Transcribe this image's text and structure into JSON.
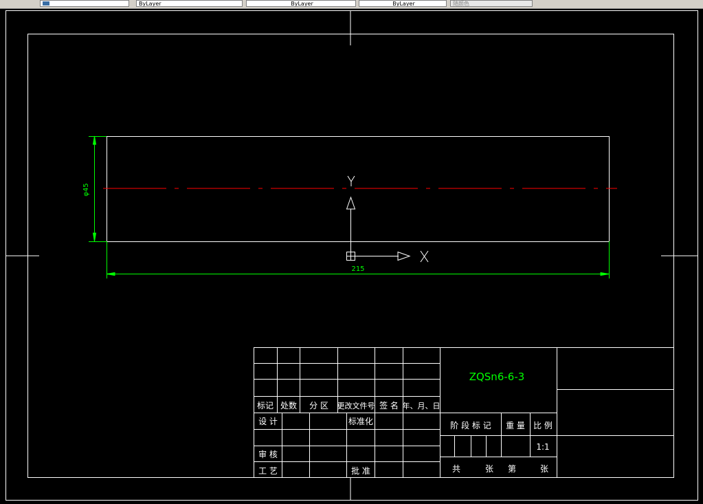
{
  "toolbar": {
    "layer_label": "ByLayer",
    "linetype_label": "ByLayer",
    "lineweight_label": "ByLayer",
    "plotstyle_label": "随颜色"
  },
  "drawing": {
    "dim_diameter": "φ45",
    "dim_length": "215",
    "ucs_y": "Y",
    "ucs_x": "X",
    "colors": {
      "background": "#000000",
      "lines": "#ffffff",
      "dimension": "#00ff00",
      "centerline": "#ff0000"
    }
  },
  "title_block": {
    "material": "ZQSn6-6-3",
    "rev_headers": [
      "标记",
      "处数",
      "分 区",
      "更改文件号",
      "签 名",
      "年、月、日"
    ],
    "design": "设 计",
    "standardize": "标准化",
    "review": "审 核",
    "process": "工 艺",
    "approve": "批 准",
    "stage_mark": "阶 段 标 记",
    "weight": "重 量",
    "scale_label": "比 例",
    "scale_value": "1:1",
    "total": "共",
    "sheets1": "张",
    "number": "第",
    "sheets2": "张"
  }
}
